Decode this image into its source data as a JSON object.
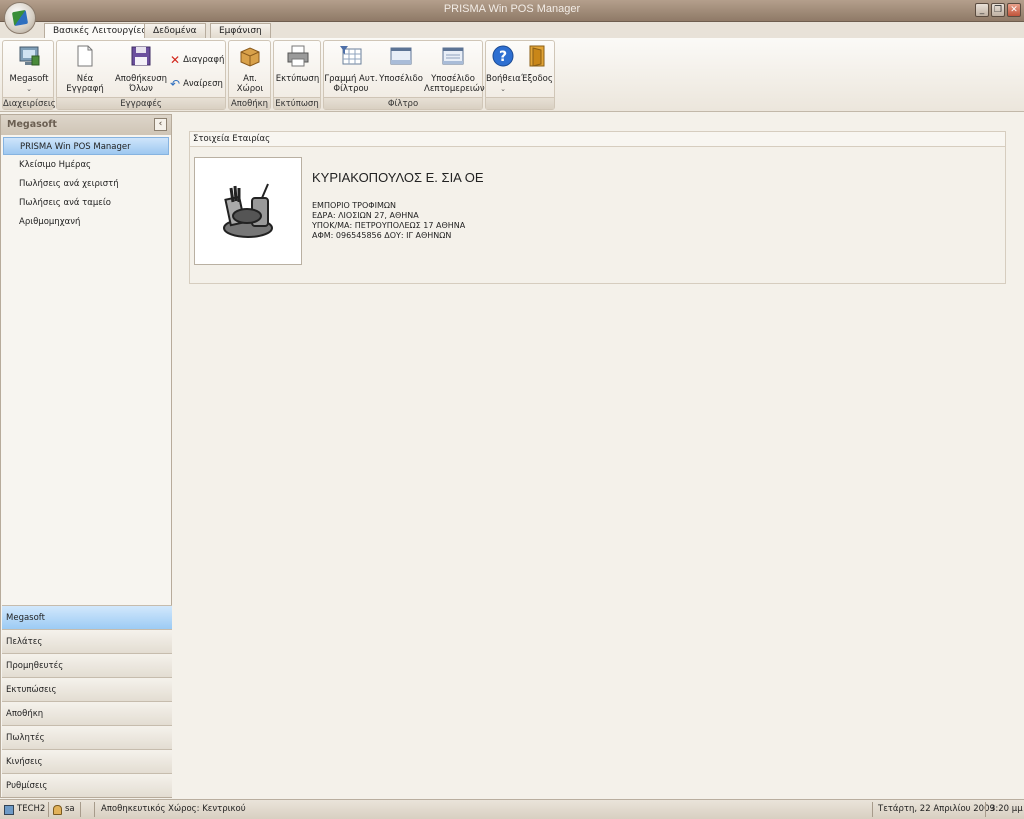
{
  "window": {
    "title": "PRISMA Win POS Manager"
  },
  "tabs": [
    "Βασικές Λειτουργίες",
    "Δεδομένα",
    "Εμφάνιση"
  ],
  "ribbon": {
    "groups": {
      "management": "Διαχειρίσεις",
      "records": "Εγγραφές",
      "warehouse": "Αποθήκη",
      "print": "Εκτύπωση",
      "filter": "Φίλτρο"
    },
    "buttons": {
      "megasoft": "Megasoft",
      "new_record": "Νέα Εγγραφή",
      "save_all_1": "Αποθήκευση",
      "save_all_2": "Όλων",
      "delete": "Διαγραφή",
      "undo": "Αναίρεση",
      "warehouses": "Απ. Χώροι",
      "print": "Εκτύπωση",
      "filter_line_1": "Γραμμή Αυτ.",
      "filter_line_2": "Φίλτρου",
      "footer": "Υποσέλιδο",
      "detail_footer_1": "Υποσέλιδο",
      "detail_footer_2": "Λεπτομερειών",
      "help": "Βοήθεια",
      "exit": "Έξοδος"
    }
  },
  "sidebar": {
    "title": "Megasoft",
    "items": [
      "PRISMA Win POS Manager",
      "Κλείσιμο Ημέρας",
      "Πωλήσεις ανά χειριστή",
      "Πωλήσεις ανά ταμείο",
      "Αριθμομηχανή"
    ],
    "nav": [
      "Megasoft",
      "Πελάτες",
      "Προμηθευτές",
      "Εκτυπώσεις",
      "Αποθήκη",
      "Πωλητές",
      "Κινήσεις",
      "Ρυθμίσεις"
    ]
  },
  "company": {
    "section_title": "Στοιχεία Εταιρίας",
    "name": "ΚΥΡΙΑΚΟΠΟΥΛΟΣ Ε.  ΣΙΑ ΟΕ",
    "lines": [
      "ΕΜΠΟΡΙΟ ΤΡΟΦΙΜΩΝ",
      "ΕΔΡΑ: ΛΙΟΣΙΩΝ 27, ΑΘΗΝΑ",
      "ΥΠΟΚ/ΜΑ: ΠΕΤΡΟΥΠΟΛΕΩΣ 17 ΑΘΗΝΑ",
      "ΑΦΜ: 096545856 ΔΟΥ: ΙΓ ΑΘΗΝΩΝ"
    ]
  },
  "status": {
    "machine": "TECH2",
    "user": "sa",
    "warehouse": "Αποθηκευτικός Χώρος: Κεντρικού",
    "date": "Τετάρτη, 22 Απριλίου 2009",
    "time": "3:20 μμ"
  }
}
